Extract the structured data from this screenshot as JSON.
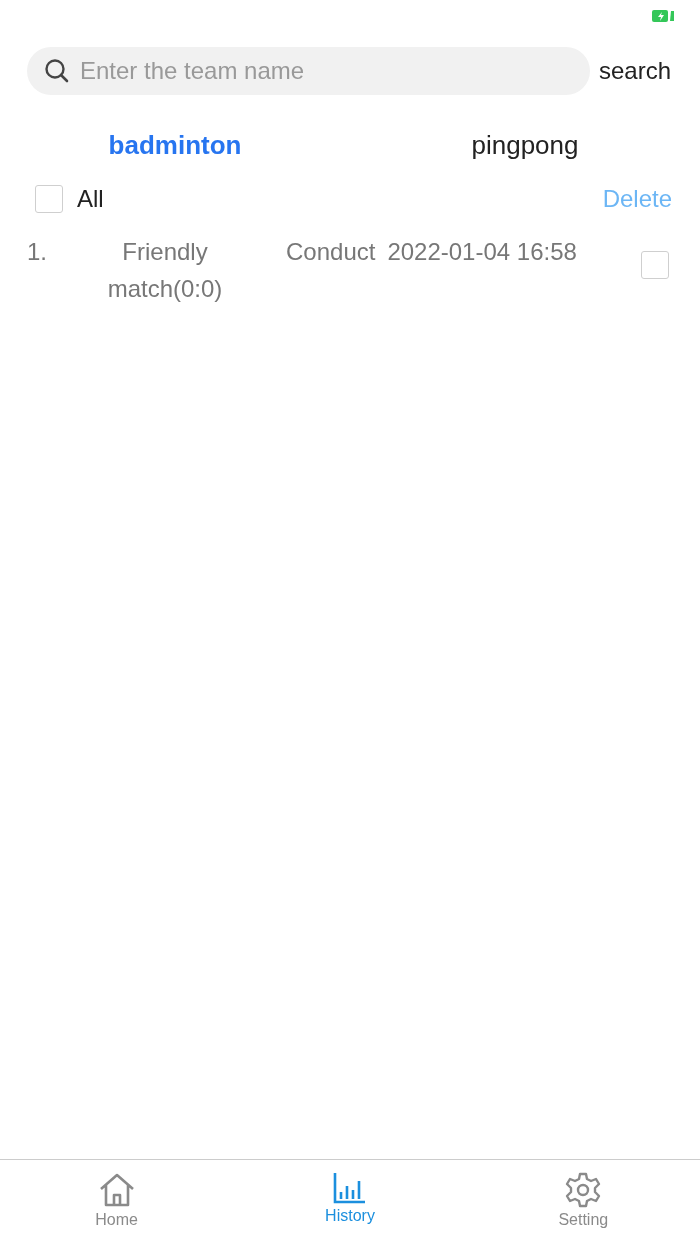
{
  "search": {
    "placeholder": "Enter the team name",
    "button": "search"
  },
  "tabs": [
    {
      "label": "badminton",
      "selected": true
    },
    {
      "label": "pingpong",
      "selected": false
    }
  ],
  "select_all": {
    "label": "All",
    "checked": false
  },
  "delete_label": "Delete",
  "records": [
    {
      "index": "1.",
      "name": "Friendly match(0:0)",
      "status": "Conduct",
      "time": "2022-01-04 16:58",
      "checked": false
    }
  ],
  "tabbar": [
    {
      "label": "Home",
      "kind": "home",
      "selected": false
    },
    {
      "label": "History",
      "kind": "chart",
      "selected": true
    },
    {
      "label": "Setting",
      "kind": "gear",
      "selected": false
    }
  ]
}
